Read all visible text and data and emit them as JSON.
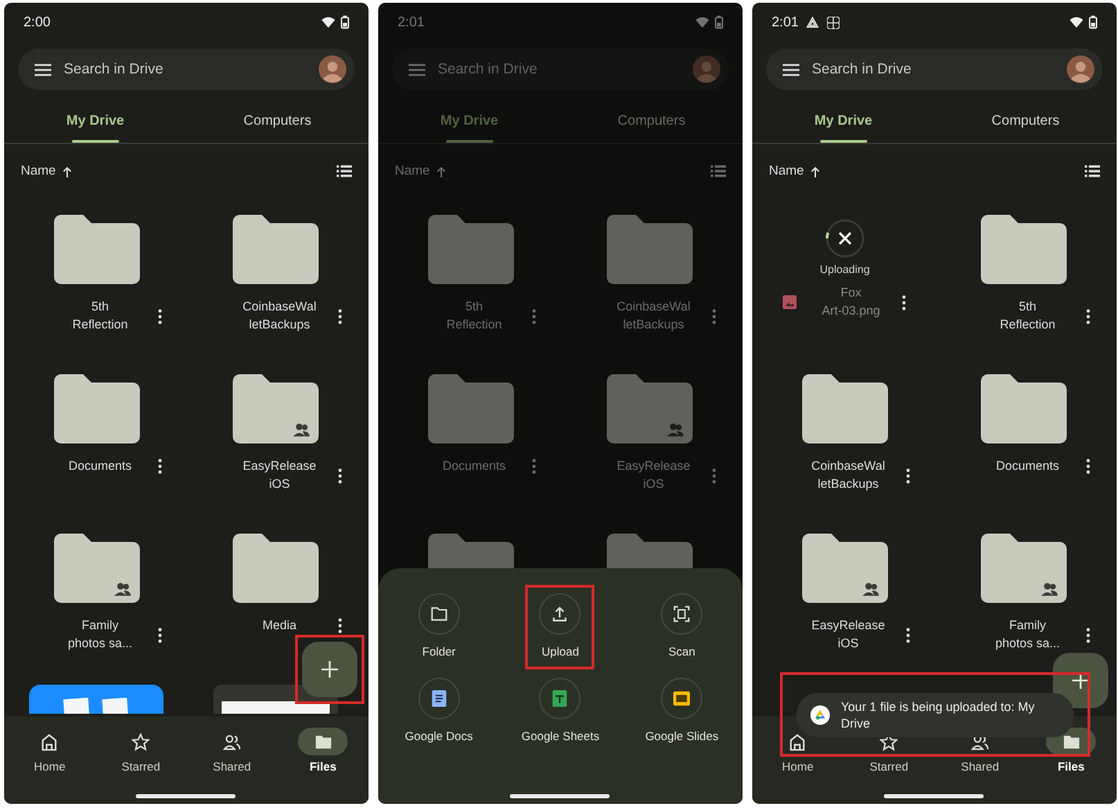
{
  "phones": [
    {
      "status_time": "2:00",
      "search": {
        "placeholder": "Search in Drive"
      },
      "tabs": [
        {
          "label": "My Drive",
          "selected": true
        },
        {
          "label": "Computers",
          "selected": false
        }
      ],
      "sort_label": "Name",
      "items": [
        {
          "kind": "folder",
          "lines": [
            "5th",
            "Reflection"
          ],
          "shared": false
        },
        {
          "kind": "folder",
          "lines": [
            "CoinbaseWal",
            "letBackups"
          ],
          "shared": false
        },
        {
          "kind": "folder",
          "lines": [
            "Documents"
          ],
          "shared": false
        },
        {
          "kind": "folder",
          "lines": [
            "EasyRelease",
            "iOS"
          ],
          "shared": true
        },
        {
          "kind": "folder",
          "lines": [
            "Family",
            "photos sa..."
          ],
          "shared": true
        },
        {
          "kind": "folder",
          "lines": [
            "Media"
          ],
          "shared": false
        },
        {
          "kind": "photo"
        },
        {
          "kind": "document"
        }
      ],
      "fab": {
        "highlighted": true
      },
      "nav": [
        {
          "label": "Home",
          "selected": false
        },
        {
          "label": "Starred",
          "selected": false
        },
        {
          "label": "Shared",
          "selected": false
        },
        {
          "label": "Files",
          "selected": true
        }
      ]
    },
    {
      "status_time": "2:01",
      "dimmed": true,
      "search": {
        "placeholder": "Search in Drive"
      },
      "tabs": [
        {
          "label": "My Drive",
          "selected": true
        },
        {
          "label": "Computers",
          "selected": false
        }
      ],
      "sort_label": "Name",
      "items": [
        {
          "kind": "folder",
          "lines": [
            "5th",
            "Reflection"
          ],
          "shared": false
        },
        {
          "kind": "folder",
          "lines": [
            "CoinbaseWal",
            "letBackups"
          ],
          "shared": false
        },
        {
          "kind": "folder",
          "lines": [
            "Documents"
          ],
          "shared": false
        },
        {
          "kind": "folder",
          "lines": [
            "EasyRelease",
            "iOS"
          ],
          "shared": true
        },
        {
          "kind": "folder"
        },
        {
          "kind": "folder"
        }
      ],
      "sheet": {
        "actions": [
          {
            "label": "Folder",
            "highlighted": false
          },
          {
            "label": "Upload",
            "highlighted": true
          },
          {
            "label": "Scan",
            "highlighted": false
          },
          {
            "label": "Google Docs",
            "highlighted": false
          },
          {
            "label": "Google Sheets",
            "highlighted": false
          },
          {
            "label": "Google Slides",
            "highlighted": false
          }
        ]
      }
    },
    {
      "status_time": "2:01",
      "notification_icons": true,
      "search": {
        "placeholder": "Search in Drive"
      },
      "tabs": [
        {
          "label": "My Drive",
          "selected": true
        },
        {
          "label": "Computers",
          "selected": false
        }
      ],
      "sort_label": "Name",
      "items": [
        {
          "kind": "upload",
          "status": "Uploading",
          "lines": [
            "Fox",
            "Art-03.png"
          ],
          "level": 0.05
        },
        {
          "kind": "folder",
          "lines": [
            "5th",
            "Reflection"
          ],
          "shared": false
        },
        {
          "kind": "folder",
          "lines": [
            "CoinbaseWal",
            "letBackups"
          ],
          "shared": false
        },
        {
          "kind": "folder",
          "lines": [
            "Documents"
          ],
          "shared": false
        },
        {
          "kind": "folder",
          "lines": [
            "EasyRelease",
            "iOS"
          ],
          "shared": true
        },
        {
          "kind": "folder",
          "lines": [
            "Family",
            "photos sa..."
          ],
          "shared": true
        }
      ],
      "fab": {
        "highlighted": false
      },
      "toast": {
        "text": "Your 1 file is being uploaded to: My Drive",
        "highlighted": true
      },
      "nav": [
        {
          "label": "Home",
          "selected": false
        },
        {
          "label": "Starred",
          "selected": false
        },
        {
          "label": "Shared",
          "selected": false
        },
        {
          "label": "Files",
          "selected": true
        }
      ]
    }
  ]
}
